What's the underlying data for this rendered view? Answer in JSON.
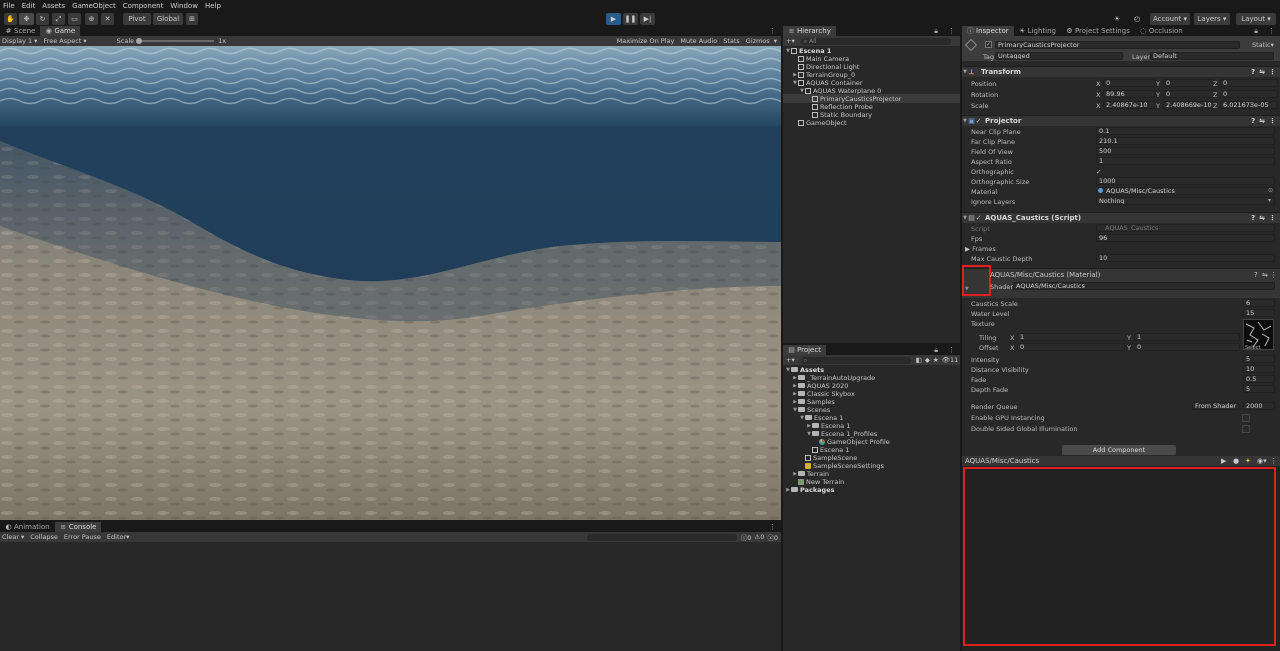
{
  "menu": [
    "File",
    "Edit",
    "Assets",
    "GameObject",
    "Component",
    "Window",
    "Help"
  ],
  "toolbar": {
    "pivot": "Pivot",
    "global": "Global",
    "account": "Account",
    "layers": "Layers",
    "layout": "Layout"
  },
  "game": {
    "tabs": [
      "Scene",
      "Game"
    ],
    "display": "Display 1",
    "aspect": "Free Aspect",
    "scale_label": "Scale",
    "scale_value": "1x",
    "options": [
      "Maximize On Play",
      "Mute Audio",
      "Stats",
      "Gizmos"
    ]
  },
  "console": {
    "tabs": [
      "Animation",
      "Console"
    ],
    "items": [
      "Clear",
      "Collapse",
      "Error Pause",
      "Editor"
    ],
    "counts": [
      "0",
      "0",
      "0"
    ]
  },
  "hierarchy": {
    "title": "Hierarchy",
    "search": "All",
    "items": [
      {
        "label": "Escena 1",
        "indent": 0,
        "bold": true,
        "tri": "▼"
      },
      {
        "label": "Main Camera",
        "indent": 1,
        "tri": ""
      },
      {
        "label": "Directional Light",
        "indent": 1,
        "tri": ""
      },
      {
        "label": "TerrainGroup_0",
        "indent": 1,
        "tri": "▶"
      },
      {
        "label": "AQUAS Container",
        "indent": 1,
        "tri": "▼"
      },
      {
        "label": "AQUAS Waterplane 0",
        "indent": 2,
        "tri": "▼"
      },
      {
        "label": "PrimaryCausticsProjector",
        "indent": 3,
        "tri": "",
        "selected": true
      },
      {
        "label": "Reflection Probe",
        "indent": 3,
        "tri": ""
      },
      {
        "label": "Static Boundary",
        "indent": 3,
        "tri": ""
      },
      {
        "label": "GameObject",
        "indent": 1,
        "tri": ""
      }
    ]
  },
  "project": {
    "title": "Project",
    "count": "11",
    "items": [
      {
        "label": "Assets",
        "indent": 0,
        "bold": true,
        "tri": "▼",
        "type": "folder"
      },
      {
        "label": "_TerrainAutoUpgrade",
        "indent": 1,
        "tri": "▶",
        "type": "folder"
      },
      {
        "label": "AQUAS 2020",
        "indent": 1,
        "tri": "▶",
        "type": "folder"
      },
      {
        "label": "Classic Skybox",
        "indent": 1,
        "tri": "▶",
        "type": "folder"
      },
      {
        "label": "Samples",
        "indent": 1,
        "tri": "▶",
        "type": "folder"
      },
      {
        "label": "Scenes",
        "indent": 1,
        "tri": "▼",
        "type": "folder"
      },
      {
        "label": "Escena 1",
        "indent": 2,
        "tri": "▼",
        "type": "folder"
      },
      {
        "label": "Escena 1",
        "indent": 3,
        "tri": "▶",
        "type": "folder"
      },
      {
        "label": "Escena 1_Profiles",
        "indent": 3,
        "tri": "▼",
        "type": "folder"
      },
      {
        "label": "GameObject Profile",
        "indent": 4,
        "tri": "",
        "type": "profile"
      },
      {
        "label": "Escena 1",
        "indent": 3,
        "tri": "",
        "type": "scene"
      },
      {
        "label": "SampleScene",
        "indent": 2,
        "tri": "",
        "type": "scene"
      },
      {
        "label": "SampleSceneSettings",
        "indent": 2,
        "tri": "",
        "type": "settings"
      },
      {
        "label": "Terrain",
        "indent": 1,
        "tri": "▶",
        "type": "folder"
      },
      {
        "label": "New Terrain",
        "indent": 1,
        "tri": "",
        "type": "terrain"
      },
      {
        "label": "Packages",
        "indent": 0,
        "bold": true,
        "tri": "▶",
        "type": "folder"
      }
    ]
  },
  "inspector": {
    "tabs": [
      "Inspector",
      "Lighting",
      "Project Settings",
      "Occlusion"
    ],
    "object_name": "PrimaryCausticsProjector",
    "static_label": "Static",
    "tag_label": "Tag",
    "tag": "Untagged",
    "layer_label": "Layer",
    "layer": "Default",
    "transform": {
      "title": "Transform",
      "rows": [
        {
          "label": "Position",
          "x": "0",
          "y": "0",
          "z": "0"
        },
        {
          "label": "Rotation",
          "x": "89.96",
          "y": "0",
          "z": "0"
        },
        {
          "label": "Scale",
          "x": "2.40867e-10",
          "y": "2.408669e-10",
          "z": "6.021673e-05"
        }
      ]
    },
    "projector": {
      "title": "Projector",
      "rows": [
        {
          "label": "Near Clip Plane",
          "value": "0.1"
        },
        {
          "label": "Far Clip Plane",
          "value": "210.1"
        },
        {
          "label": "Field Of View",
          "value": "500"
        },
        {
          "label": "Aspect Ratio",
          "value": "1"
        },
        {
          "label": "Orthographic",
          "value": "✓"
        },
        {
          "label": "Orthographic Size",
          "value": "1000"
        },
        {
          "label": "Material",
          "value": "AQUAS/Misc/Caustics"
        },
        {
          "label": "Ignore Layers",
          "value": "Nothing"
        }
      ]
    },
    "caustics": {
      "title": "AQUAS_Caustics (Script)",
      "rows": [
        {
          "label": "Script",
          "value": "AQUAS_Caustics"
        },
        {
          "label": "Fps",
          "value": "96"
        },
        {
          "label": "Frames",
          "value": ""
        },
        {
          "label": "Max Caustic Depth",
          "value": "10"
        }
      ]
    },
    "material": {
      "title": "AQUAS/Misc/Caustics (Material)",
      "shader_label": "Shader",
      "shader": "AQUAS/Misc/Caustics",
      "rows": [
        {
          "label": "Caustics Scale",
          "value": "6"
        },
        {
          "label": "Water Level",
          "value": "15"
        },
        {
          "label": "Texture",
          "value": ""
        }
      ],
      "tiling_label": "Tiling",
      "offset_label": "Offset",
      "tiling": {
        "x": "1",
        "y": "1"
      },
      "offset": {
        "x": "0",
        "y": "0"
      },
      "select": "Select",
      "rows2": [
        {
          "label": "Intensity",
          "value": "5"
        },
        {
          "label": "Distance Visibility",
          "value": "10"
        },
        {
          "label": "Fade",
          "value": "0.5"
        },
        {
          "label": "Depth Fade",
          "value": "5"
        }
      ],
      "render_queue_label": "Render Queue",
      "render_queue_mode": "From Shader",
      "render_queue": "2000",
      "gpu": "Enable GPU Instancing",
      "dsgi": "Double Sided Global Illumination"
    },
    "add_component": "Add Component",
    "preview_title": "AQUAS/Misc/Caustics"
  },
  "colors": {
    "highlight": "#e02020",
    "selected": "#2c5d87",
    "play": "#1d4f7a"
  }
}
